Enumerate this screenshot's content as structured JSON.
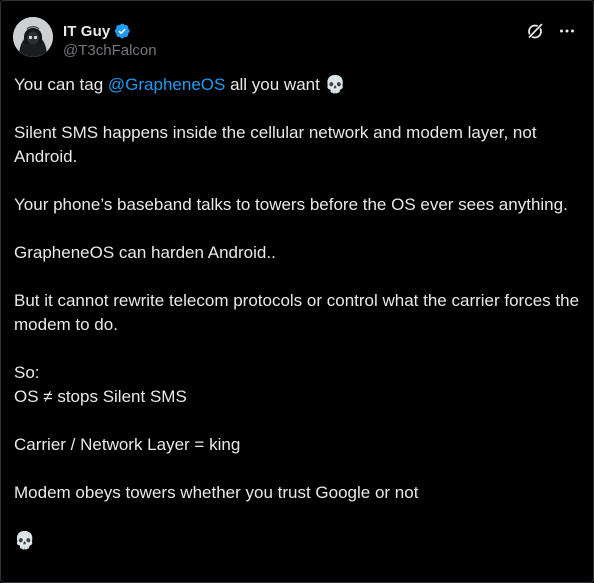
{
  "author": {
    "display_name": "IT Guy",
    "handle": "@T3chFalcon",
    "verified": true
  },
  "icons": {
    "avatar": "hooded-figure-avatar",
    "verified": "verified-badge-icon",
    "grok": "grok-icon",
    "more": "more-options-icon",
    "emoji": "skull-emoji"
  },
  "colors": {
    "background": "#000000",
    "text": "#e7e9ea",
    "muted": "#71767b",
    "link": "#1d9bf0",
    "verified": "#1d9bf0"
  },
  "post": {
    "line1_prefix": "You can tag ",
    "mention": "@GrapheneOS",
    "line1_suffix": " all you want ",
    "skull": "💀",
    "p2": "Silent SMS happens inside the cellular network and modem layer, not Android.",
    "p3": "Your phone’s baseband talks to towers before the OS ever sees anything.",
    "p4": "GrapheneOS can harden Android..",
    "p5": "But it cannot rewrite telecom protocols or control what the carrier forces the modem to do.",
    "p6_line1": "So:",
    "p6_line2": "OS ≠ stops Silent SMS",
    "p7": "Carrier / Network Layer = king",
    "p8": "Modem obeys towers whether you trust Google or not",
    "final_emoji": "💀"
  }
}
